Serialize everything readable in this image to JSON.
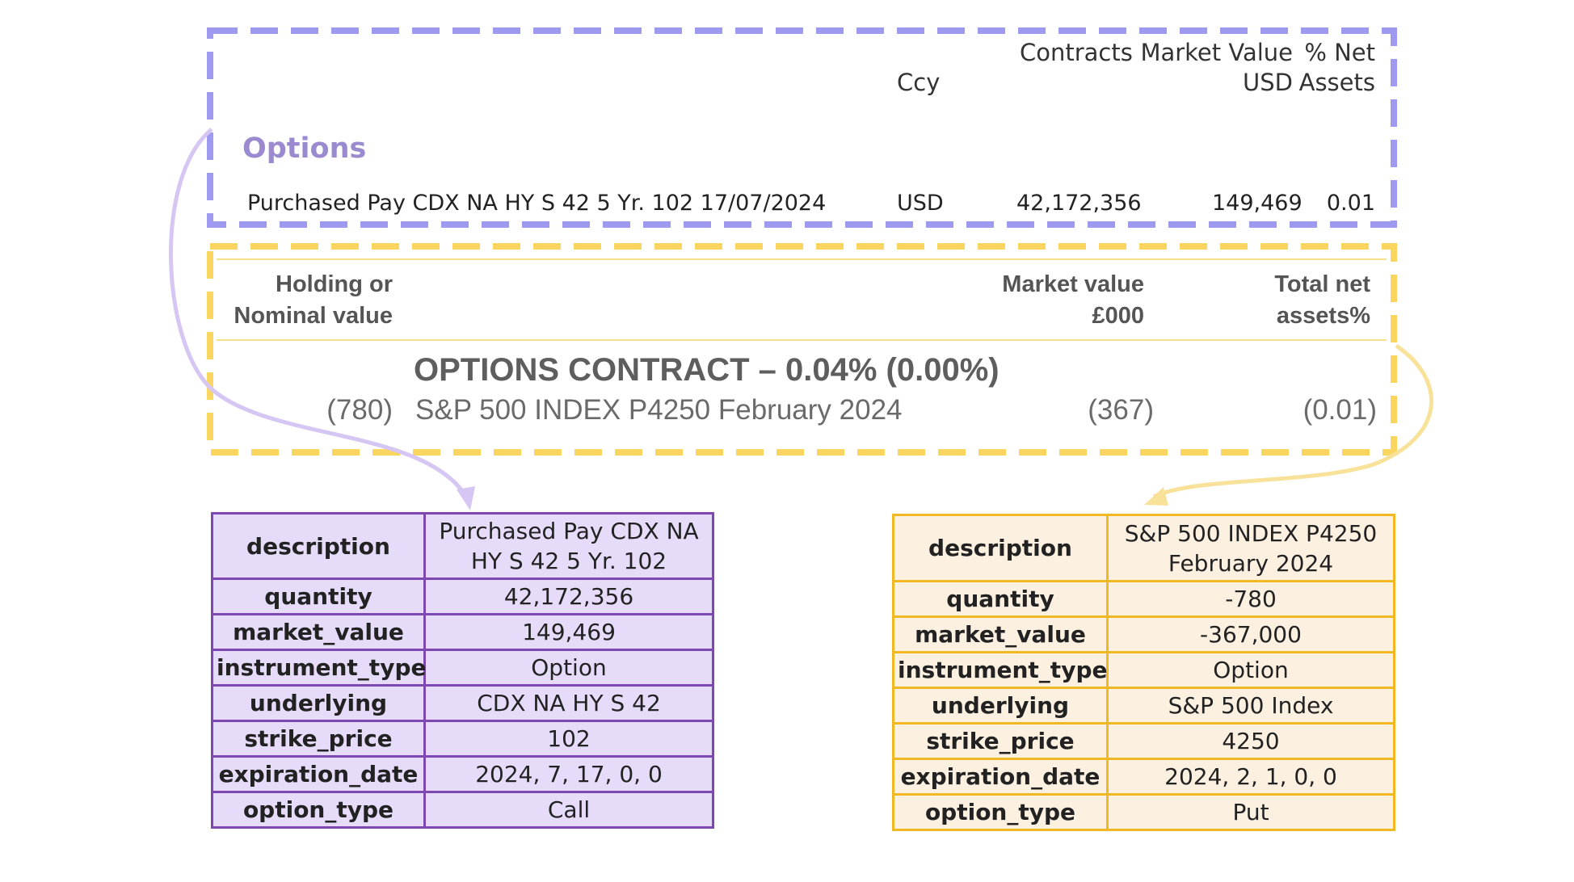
{
  "source_purple": {
    "headers": {
      "ccy": "Ccy",
      "contracts": "Contracts",
      "market_value": [
        "Market Value",
        "USD"
      ],
      "net_assets": [
        "% Net",
        "Assets"
      ]
    },
    "section": "Options",
    "row": {
      "description": "Purchased Pay CDX NA HY S 42 5 Yr. 102 17/07/2024",
      "ccy": "USD",
      "contracts": "42,172,356",
      "market_value": "149,469",
      "net_assets": "0.01"
    }
  },
  "source_yellow": {
    "headers": {
      "holding": [
        "Holding or",
        "Nominal value"
      ],
      "market_value": [
        "Market value",
        "£000"
      ],
      "total_net_assets": [
        "Total net",
        "assets%"
      ]
    },
    "section": "OPTIONS CONTRACT – 0.04% (0.00%)",
    "row": {
      "holding": "(780)",
      "description": "S&P 500 INDEX P4250 February 2024",
      "market_value": "(367)",
      "total_net_assets": "(0.01)"
    }
  },
  "extracted_purple": [
    {
      "key": "description",
      "value": "Purchased Pay CDX NA HY S 42 5 Yr. 102"
    },
    {
      "key": "quantity",
      "value": "42,172,356"
    },
    {
      "key": "market_value",
      "value": "149,469"
    },
    {
      "key": "instrument_type",
      "value": "Option"
    },
    {
      "key": "underlying",
      "value": "CDX NA HY S 42"
    },
    {
      "key": "strike_price",
      "value": "102"
    },
    {
      "key": "expiration_date",
      "value": "2024, 7, 17, 0, 0"
    },
    {
      "key": "option_type",
      "value": "Call"
    }
  ],
  "extracted_yellow": [
    {
      "key": "description",
      "value": "S&P 500 INDEX P4250 February 2024"
    },
    {
      "key": "quantity",
      "value": "-780"
    },
    {
      "key": "market_value",
      "value": "-367,000"
    },
    {
      "key": "instrument_type",
      "value": "Option"
    },
    {
      "key": "underlying",
      "value": "S&P 500 Index"
    },
    {
      "key": "strike_price",
      "value": "4250"
    },
    {
      "key": "expiration_date",
      "value": "2024, 2, 1, 0, 0"
    },
    {
      "key": "option_type",
      "value": "Put"
    }
  ],
  "colors": {
    "purple_frame": "#9d9af0",
    "purple_cell_border": "#7e48b3",
    "purple_cell_fill": "#e7dbfa",
    "purple_connector": "#d6c6f4",
    "yellow_frame": "#fad660",
    "yellow_cell_border": "#f2b824",
    "yellow_cell_fill": "#fcf0e1",
    "yellow_connector": "#f8e29a"
  }
}
